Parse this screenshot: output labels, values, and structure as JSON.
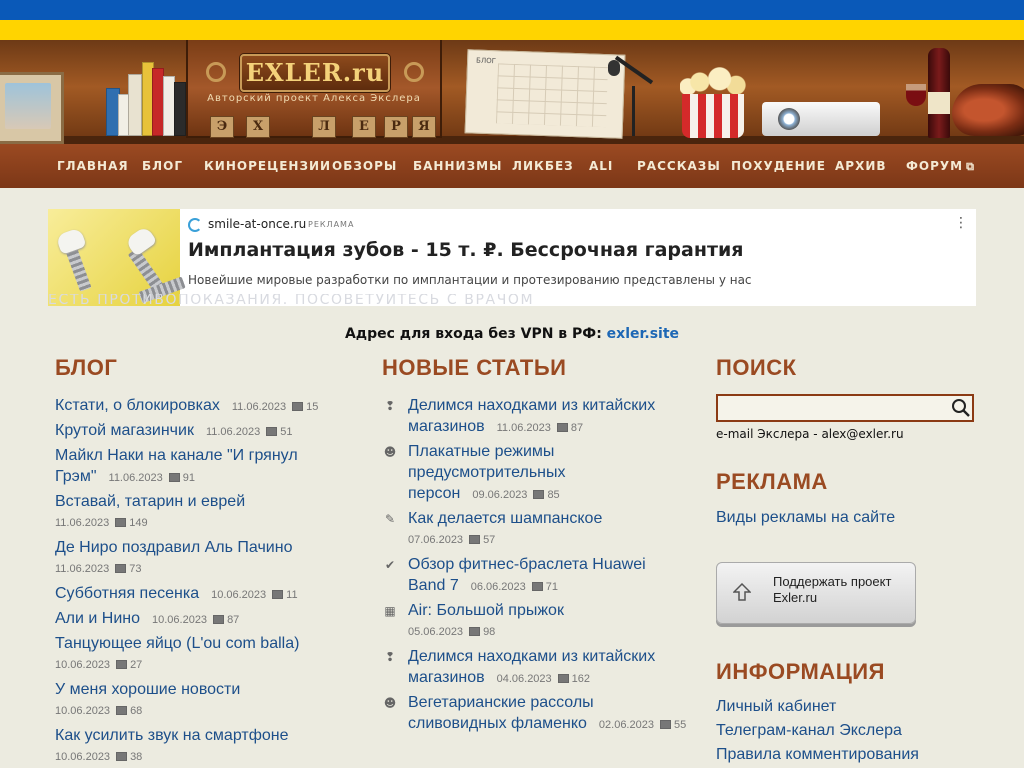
{
  "header": {
    "logo": "EXLER.ru",
    "tagline": "Авторский проект Алекса Экслера",
    "calendar_title": "БЛОГ",
    "plaques": [
      "Э",
      "Х",
      "Л",
      "Е",
      "Р",
      "Я"
    ]
  },
  "nav": {
    "items": [
      "Главная",
      "Блог",
      "Кинорецензии",
      "Обзоры",
      "Баннизмы",
      "Ликбез",
      "ALI",
      "Рассказы",
      "Похудение",
      "Архив",
      "Форум"
    ]
  },
  "ad": {
    "domain": "smile-at-once.ru",
    "mark": "РЕКЛАМА",
    "title": "Имплантация зубов - 15 т. ₽. Бессрочная гарантия",
    "description": "Новейшие мировые разработки по имплантации и протезированию представлены у нас",
    "warning": "Есть противопоказания. Посоветуйтесь с врачом",
    "more": "⋮"
  },
  "vpn": {
    "label": "Адрес для входа без VPN в РФ: ",
    "link": "exler.site"
  },
  "blog": {
    "title": "Блог",
    "posts": [
      {
        "title": "Кстати, о блокировках",
        "date": "11.06.2023",
        "comments": "15"
      },
      {
        "title": "Крутой магазинчик",
        "date": "11.06.2023",
        "comments": "51"
      },
      {
        "title": "Майкл Наки на канале \"И грянул Грэм\"",
        "date": "11.06.2023",
        "comments": "91"
      },
      {
        "title": "Вставай, татарин и еврей",
        "date": "11.06.2023",
        "comments": "149"
      },
      {
        "title": "Де Ниро поздравил Аль Пачино",
        "date": "11.06.2023",
        "comments": "73"
      },
      {
        "title": "Субботняя песенка",
        "date": "10.06.2023",
        "comments": "11"
      },
      {
        "title": "Али и Нино",
        "date": "10.06.2023",
        "comments": "87"
      },
      {
        "title": "Танцующее яйцо (L'ou com balla)",
        "date": "10.06.2023",
        "comments": "27"
      },
      {
        "title": "У меня хорошие новости",
        "date": "10.06.2023",
        "comments": "68"
      },
      {
        "title": "Как усилить звук на смартфоне",
        "date": "10.06.2023",
        "comments": "38"
      }
    ]
  },
  "articles": {
    "title": "Новые статьи",
    "items": [
      {
        "icon": "❢",
        "l1": "Делимся находками из китайских",
        "l2": "магазинов",
        "date": "11.06.2023",
        "comments": "87"
      },
      {
        "icon": "☻",
        "l1": "Плакатные режимы",
        "l2": "предусмотрительных персон",
        "date": "09.06.2023",
        "comments": "85"
      },
      {
        "icon": "✎",
        "l1": "Как делается шампанское",
        "l2": "",
        "date": "07.06.2023",
        "comments": "57"
      },
      {
        "icon": "✔",
        "l1": "Обзор фитнес-браслета Huawei",
        "l2": "Band 7",
        "date": "06.06.2023",
        "comments": "71"
      },
      {
        "icon": "▦",
        "l1": "Air: Большой прыжок",
        "l2": "",
        "date": "05.06.2023",
        "comments": "98"
      },
      {
        "icon": "❢",
        "l1": "Делимся находками из китайских",
        "l2": "магазинов",
        "date": "04.06.2023",
        "comments": "162"
      },
      {
        "icon": "☻",
        "l1": "Вегетарианские рассолы",
        "l2": "сливовидных фламенко",
        "date": "02.06.2023",
        "comments": "55"
      }
    ]
  },
  "sidebar": {
    "search_title": "Поиск",
    "email": "e-mail Экслера - alex@exler.ru",
    "ads_title": "Реклама",
    "ads_link": "Виды рекламы на сайте",
    "support": "Поддержать проект Exler.ru",
    "info_title": "Информация",
    "info_links": [
      "Личный кабинет",
      "Телеграм-канал Экслера",
      "Правила комментирования"
    ]
  }
}
